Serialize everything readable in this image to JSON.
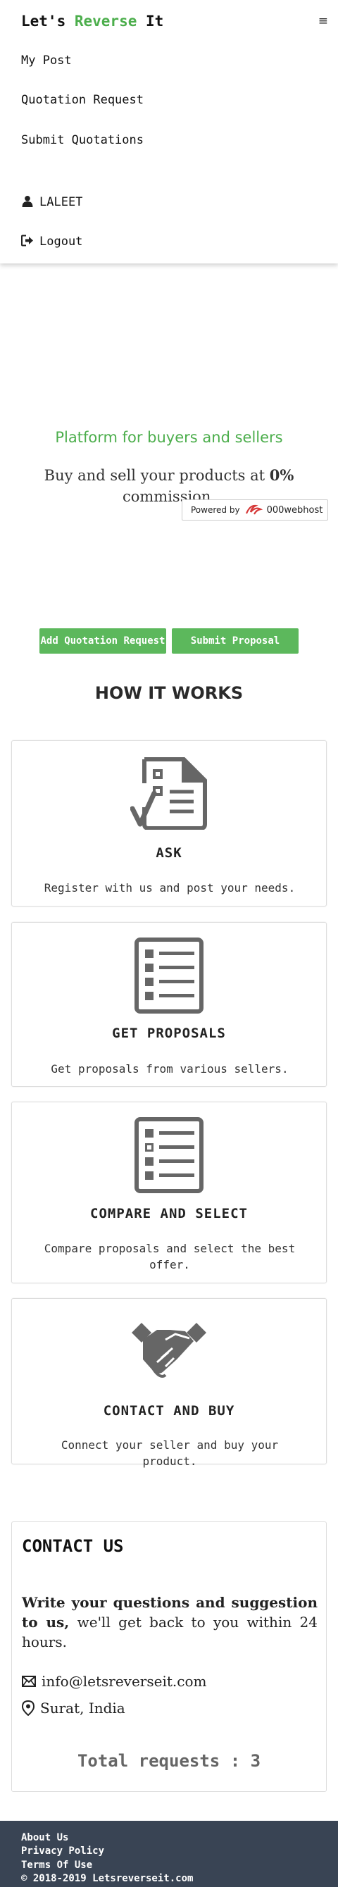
{
  "brand": {
    "part1": "Let's ",
    "part2": "Reverse",
    "part3": " It"
  },
  "menu_icon": "≡",
  "nav": {
    "items": [
      {
        "label": "My Post"
      },
      {
        "label": "Quotation Request"
      },
      {
        "label": "Submit Quotations"
      }
    ],
    "user": "LALEET",
    "logout": "Logout"
  },
  "hero": {
    "title": "Platform for buyers and sellers",
    "sub_before": "Buy and sell your products at ",
    "sub_bold": "0%",
    "sub_after": " commission.",
    "powered_label": "Powered by",
    "powered_host": "000webhost"
  },
  "buttons": {
    "add_quotation": "Add Quotation Request",
    "submit_proposal": "Submit Proposal"
  },
  "how_title": "HOW IT WORKS",
  "steps": [
    {
      "title": "ASK",
      "text": "Register with us and post your needs.",
      "icon": "document-check-icon"
    },
    {
      "title": "GET PROPOSALS",
      "text": "Get proposals from various sellers.",
      "icon": "list-icon"
    },
    {
      "title": "COMPARE AND SELECT",
      "text": "Compare proposals and select the best offer.",
      "icon": "checklist-icon"
    },
    {
      "title": "CONTACT AND BUY",
      "text": "Connect your seller and buy your product.",
      "icon": "handshake-icon"
    }
  ],
  "contact": {
    "title": "CONTACT US",
    "msg_bold": "Write your questions and suggestion to us,",
    "msg_rest": " we'll get back to you within 24 hours.",
    "email": "info@letsreverseit.com",
    "location": "Surat, India",
    "total": "Total requests : 3"
  },
  "footer": {
    "about": "About Us",
    "privacy": "Privacy Policy",
    "terms": "Terms Of Use",
    "copyright": "© 2018-2019 Letsreverseit.com"
  },
  "colors": {
    "accent": "#4cae4c",
    "button": "#5cb85c",
    "footer": "#394454"
  }
}
